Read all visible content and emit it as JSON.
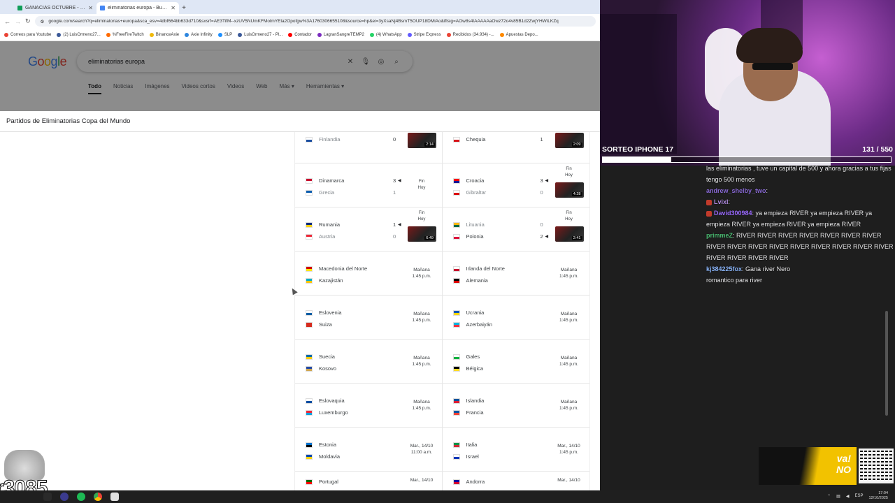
{
  "tabs": [
    {
      "title": "GANACIAS OCTUBRE - Hojas de cálculo",
      "color": "#0f9d58",
      "active": false
    },
    {
      "title": "eliminatorias europa - Buscar con Google",
      "color": "#4285f4",
      "active": true
    }
  ],
  "address": "google.com/search?q=eliminatorias+europa&sca_esv=4dbf664bb633d710&sxsrf=AE3TifM--xzUV5NUmKFMolmYEla2Opofgw%3A1760306655108&source=hp&ei=3yXsaNj4BsmT5OUP18DMiAo&iflsig=AOw8s4IAAAAAaOwz72o4v85B1d2ZwjYHWiLKZq",
  "bookmarks": [
    "Correos para Youtube",
    "(2) LuisOrmeno27...",
    "%FreeFireTwitch",
    "BinanceAxie",
    "Axie Infinity",
    "SLP",
    "LuisOrmeno27 - Pl...",
    "Contador",
    "LagranSangreTEMP2",
    "(4) WhatsApp",
    "Stripe Express",
    "Recibidos (34.934) -...",
    "Apuestas Depo..."
  ],
  "google": {
    "logo": "Google",
    "query": "eliminatorias europa",
    "nav": [
      "Todo",
      "Noticias",
      "Imágenes",
      "Videos cortos",
      "Videos",
      "Web",
      "Más ▾",
      "Herramientas ▾"
    ]
  },
  "panel_title": "Partidos de Eliminatorias Copa del Mundo",
  "matches": [
    [
      {
        "t1": {
          "name": "Finlandia",
          "flag": [
            "#fff",
            "#1b4ea0"
          ]
        },
        "s1": "0",
        "t2": null,
        "s2": null,
        "status": "",
        "video": "2:14",
        "partial": true,
        "loser": 1
      },
      {
        "t1": {
          "name": "Chequia",
          "flag": [
            "#fff",
            "#d7141a"
          ]
        },
        "s1": "1",
        "t2": null,
        "s2": null,
        "status": "",
        "video": "2:09",
        "partial": true
      }
    ],
    [
      {
        "t1": {
          "name": "Dinamarca",
          "flag": [
            "#c8102e",
            "#fff"
          ]
        },
        "s1": "3",
        "t2": {
          "name": "Grecia",
          "flag": [
            "#0d5eaf",
            "#fff"
          ]
        },
        "s2": "1",
        "winner": 1,
        "status": "Fin\nHoy",
        "video": ""
      },
      {
        "t1": {
          "name": "Croacia",
          "flag": [
            "#ff0000",
            "#171796"
          ]
        },
        "s1": "3",
        "t2": {
          "name": "Gibraltar",
          "flag": [
            "#fff",
            "#da000c"
          ]
        },
        "s2": "0",
        "winner": 1,
        "status": "Fin\nHoy",
        "video": "4:28"
      }
    ],
    [
      {
        "t1": {
          "name": "Rumania",
          "flag": [
            "#002b7f",
            "#fcd116"
          ]
        },
        "s1": "1",
        "t2": {
          "name": "Austria",
          "flag": [
            "#ed2939",
            "#fff"
          ]
        },
        "s2": "0",
        "winner": 1,
        "status": "Fin\nHoy",
        "video": "6:49"
      },
      {
        "t1": {
          "name": "Lituania",
          "flag": [
            "#fdb913",
            "#006a44"
          ]
        },
        "s1": "0",
        "t2": {
          "name": "Polonia",
          "flag": [
            "#fff",
            "#dc143c"
          ]
        },
        "s2": "2",
        "winner": 2,
        "status": "Fin\nHoy",
        "video": "2:41"
      }
    ],
    [
      {
        "t1": {
          "name": "Macedonia del Norte",
          "flag": [
            "#d20000",
            "#ffe600"
          ]
        },
        "t2": {
          "name": "Kazajistán",
          "flag": [
            "#00afca",
            "#fec50c"
          ]
        },
        "when": "Mañana\n1:45 p.m."
      },
      {
        "t1": {
          "name": "Irlanda del Norte",
          "flag": [
            "#fff",
            "#c8102e"
          ]
        },
        "t2": {
          "name": "Alemania",
          "flag": [
            "#000",
            "#dd0000"
          ]
        },
        "when": "Mañana\n1:45 p.m."
      }
    ],
    [
      {
        "t1": {
          "name": "Eslovenia",
          "flag": [
            "#fff",
            "#005da4"
          ]
        },
        "t2": {
          "name": "Suiza",
          "flag": [
            "#d52b1e",
            "#d52b1e"
          ]
        },
        "when": "Mañana\n1:45 p.m."
      },
      {
        "t1": {
          "name": "Ucrania",
          "flag": [
            "#0057b7",
            "#ffd700"
          ]
        },
        "t2": {
          "name": "Azerbaiyán",
          "flag": [
            "#00b5e2",
            "#ef3340"
          ]
        },
        "when": "Mañana\n1:45 p.m."
      }
    ],
    [
      {
        "t1": {
          "name": "Suecia",
          "flag": [
            "#006aa7",
            "#fecc00"
          ]
        },
        "t2": {
          "name": "Kosovo",
          "flag": [
            "#244aa5",
            "#d0a650"
          ]
        },
        "when": "Mañana\n1:45 p.m."
      },
      {
        "t1": {
          "name": "Gales",
          "flag": [
            "#fff",
            "#00b140"
          ]
        },
        "t2": {
          "name": "Bélgica",
          "flag": [
            "#000",
            "#fdda24"
          ]
        },
        "when": "Mañana\n1:45 p.m."
      }
    ],
    [
      {
        "t1": {
          "name": "Eslovaquia",
          "flag": [
            "#fff",
            "#0b4ea2"
          ]
        },
        "t2": {
          "name": "Luxemburgo",
          "flag": [
            "#ed2939",
            "#00a1de"
          ]
        },
        "when": "Mañana\n1:45 p.m."
      },
      {
        "t1": {
          "name": "Islandia",
          "flag": [
            "#02529c",
            "#dc1e35"
          ]
        },
        "t2": {
          "name": "Francia",
          "flag": [
            "#0055a4",
            "#ef4135"
          ]
        },
        "when": "Mañana\n1:45 p.m."
      }
    ],
    [
      {
        "t1": {
          "name": "Estonia",
          "flag": [
            "#0072ce",
            "#000"
          ]
        },
        "t2": {
          "name": "Moldavia",
          "flag": [
            "#0046ae",
            "#ffd200"
          ]
        },
        "when": "Mar., 14/10\n11:00 a.m."
      },
      {
        "t1": {
          "name": "Italia",
          "flag": [
            "#009246",
            "#ce2b37"
          ]
        },
        "t2": {
          "name": "Israel",
          "flag": [
            "#fff",
            "#0038b8"
          ]
        },
        "when": "Mar., 14/10\n1:45 p.m."
      }
    ],
    [
      {
        "t1": {
          "name": "Portugal",
          "flag": [
            "#006600",
            "#ff0000"
          ]
        },
        "t2": null,
        "when": "Mar., 14/10"
      },
      {
        "t1": {
          "name": "Andorra",
          "flag": [
            "#10069f",
            "#d50032"
          ]
        },
        "t2": null,
        "when": "Mar., 14/10"
      }
    ]
  ],
  "stream": {
    "sorteo_label": "SORTEO IPHONE 17",
    "sorteo_count": "131 / 550",
    "sorteo_progress": 0.238,
    "counter": "r3085",
    "ad_text_1": "va!",
    "ad_text_2": "NO"
  },
  "chat": [
    {
      "user": "",
      "text": "las eliminatorias , tuve un capital de 500 y ahora gracias a tus fijas tengo 500 menos",
      "color": "#e8e8ea"
    },
    {
      "user": "andrew_shelby_two",
      "text": ": ",
      "color": "#8a6bd6"
    },
    {
      "user": "Lvixl",
      "text": ": ",
      "color": "#b08be0"
    },
    {
      "user": "David300984",
      "text": ": ya empieza RIVER ya empieza RIVER ya empieza RIVER ya empieza RIVER ya empieza RIVER",
      "color": "#9b6bff"
    },
    {
      "user": "primmeZ",
      "text": ": RIVER RIVER RIVER RIVER RIVER RIVER RIVER RIVER RIVER RIVER RIVER RIVER RIVER RIVER RIVER RIVER RIVER RIVER RIVER RIVER",
      "color": "#4dbd74"
    },
    {
      "user": "kj384225fox",
      "text": ": Gana river Nero",
      "color": "#8ab4f8"
    },
    {
      "user": "",
      "text": "romantico para river",
      "color": "#e8e8ea"
    }
  ],
  "taskbar": {
    "lang": "ESP",
    "time": "17:04",
    "date": "12/10/2025"
  }
}
